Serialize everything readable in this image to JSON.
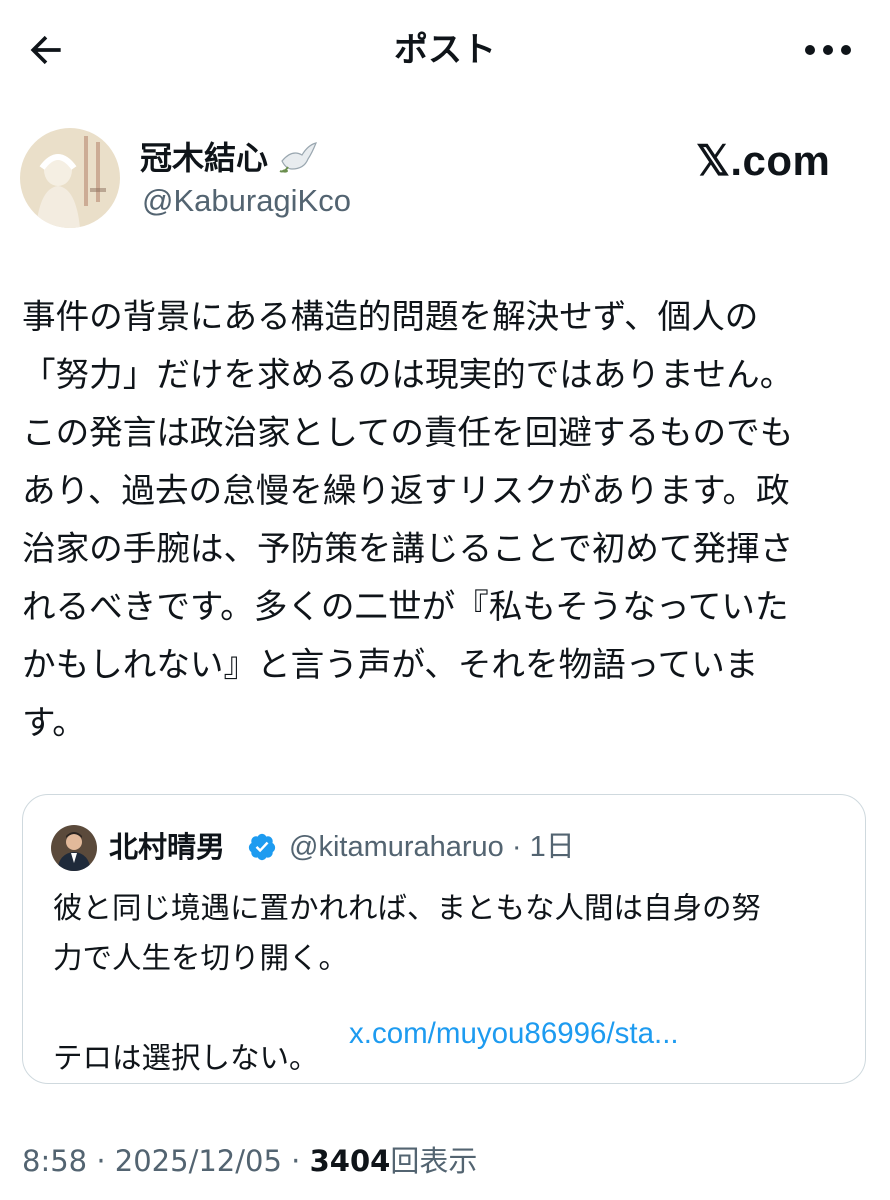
{
  "header": {
    "title": "ポスト",
    "back_icon": "arrow-left-icon",
    "more_icon": "more-horizontal-icon"
  },
  "post": {
    "author": {
      "name": "冠木結心",
      "emoji": "🕊",
      "handle": "@KaburagiKco",
      "avatar_icon": "book-cover-avatar"
    },
    "source_label": "𝕏.com",
    "body": "事件の背景にある構造的問題を解決せず、個人の\n「努力」だけを求めるのは現実的ではありません。\nこの発言は政治家としての責任を回避するものでも\nあり、過去の怠慢を繰り返すリスクがあります。政\n治家の手腕は、予防策を講じることで初めて発揮さ\nれるべきです。多くの二世が『私もそうなっていた\nかもしれない』と言う声が、それを物語っていま\nす。",
    "quoted": {
      "name": "北村晴男",
      "verified_icon": "verified-badge-icon",
      "handle": "@kitamuraharuo",
      "separator": "·",
      "time": "1日",
      "text": "彼と同じ境遇に置かれれば、まともな人間は自身の努\n力で人生を切り開く。\n\nテロは選択しない。",
      "link": "x.com/muyou86996/sta..."
    },
    "meta": {
      "time": "8:58",
      "date": "2025/12/05",
      "separator": "·",
      "views_count": "3404",
      "views_label": "回表示"
    }
  },
  "colors": {
    "text": "#0f1419",
    "muted": "#536471",
    "link": "#1d9bf0",
    "border": "#cfd9de",
    "verified": "#1d9bf0"
  }
}
